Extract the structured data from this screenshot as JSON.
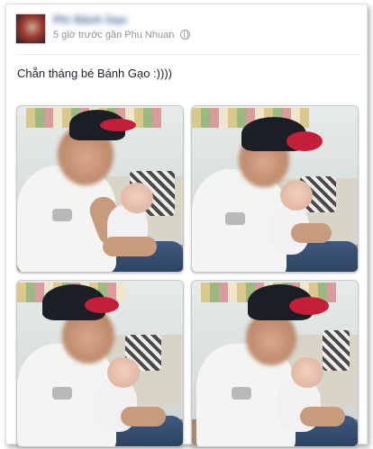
{
  "post": {
    "author_name": "Phi Bánh Gạo",
    "meta": "5 giờ trước gần Phu Nhuan",
    "privacy_icon": "globe-icon",
    "caption": "Chẵn tháng bé Bánh Gạo :))))"
  },
  "photos": [
    {
      "id": "photo-1",
      "content": "father-holding-baby"
    },
    {
      "id": "photo-2",
      "content": "father-holding-baby"
    },
    {
      "id": "photo-3",
      "content": "father-holding-baby"
    },
    {
      "id": "photo-4",
      "content": "father-holding-baby"
    }
  ],
  "colors": {
    "link_blue": "#3b5998",
    "meta_gray": "#90949c",
    "cap_red": "#c41e3a"
  }
}
